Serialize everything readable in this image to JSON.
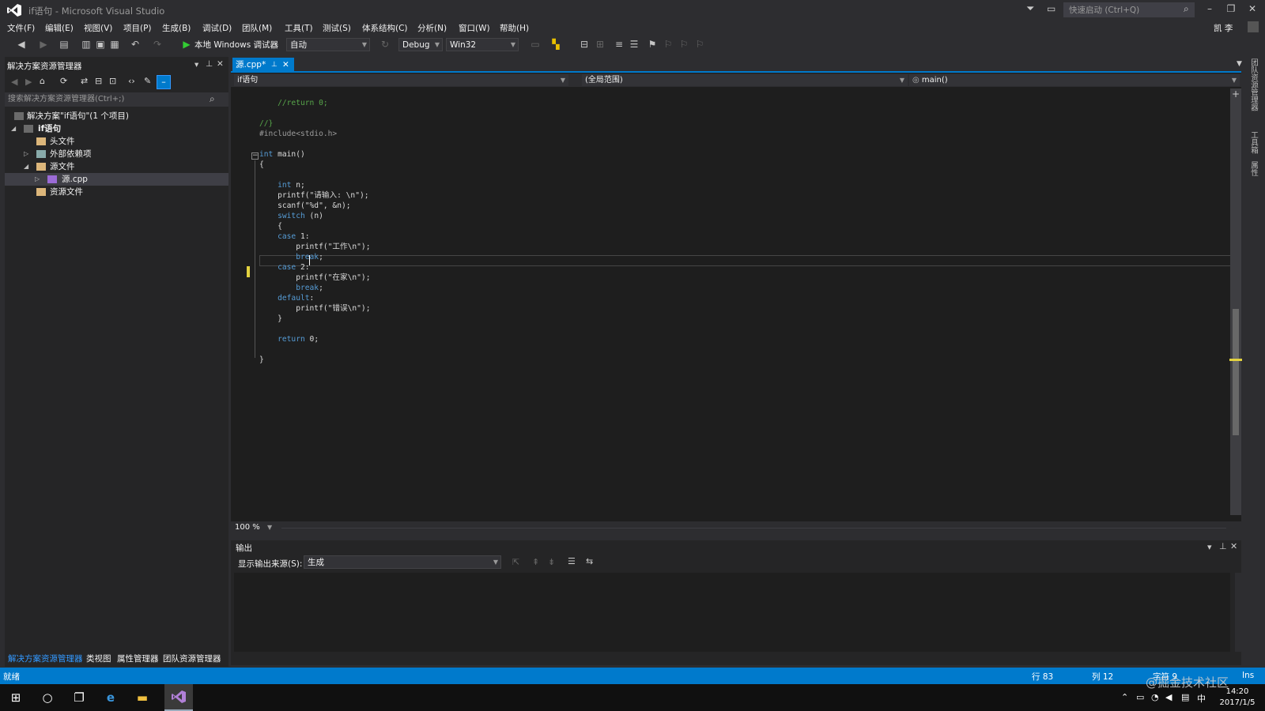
{
  "window": {
    "title": "if语句 - Microsoft Visual Studio",
    "quick_launch": "快速启动 (Ctrl+Q)",
    "user": "凯 李"
  },
  "menu": [
    "文件(F)",
    "编辑(E)",
    "视图(V)",
    "项目(P)",
    "生成(B)",
    "调试(D)",
    "团队(M)",
    "工具(T)",
    "测试(S)",
    "体系结构(C)",
    "分析(N)",
    "窗口(W)",
    "帮助(H)"
  ],
  "toolbar": {
    "run_label": "本地 Windows 调试器",
    "auto": "自动",
    "config": "Debug",
    "platform": "Win32"
  },
  "solution_explorer": {
    "title": "解决方案资源管理器",
    "search_placeholder": "搜索解决方案资源管理器(Ctrl+;)",
    "items": [
      {
        "label": "解决方案\"if语句\"(1 个项目)"
      },
      {
        "label": "if语句"
      },
      {
        "label": "头文件"
      },
      {
        "label": "外部依赖项"
      },
      {
        "label": "源文件"
      },
      {
        "label": "源.cpp"
      },
      {
        "label": "资源文件"
      }
    ],
    "tabs": [
      "解决方案资源管理器",
      "类视图",
      "属性管理器",
      "团队资源管理器"
    ]
  },
  "editor": {
    "tab_label": "源.cpp*",
    "nav_project": "if语句",
    "nav_scope": "(全局范围)",
    "nav_member": "main()",
    "zoom": "100 %",
    "lines": [
      {
        "cls": "cm",
        "text": "    //return 0;"
      },
      {
        "cls": "tx",
        "text": ""
      },
      {
        "cls": "cm",
        "text": "//}"
      },
      {
        "cls": "pp",
        "text": "#include<stdio.h>"
      },
      {
        "cls": "tx",
        "text": ""
      },
      {
        "cls": "kw",
        "text": "int",
        "rest": " main()"
      },
      {
        "cls": "tx",
        "text": "{"
      },
      {
        "cls": "tx",
        "text": ""
      },
      {
        "cls": "kw",
        "text": "    int",
        "rest": " n;"
      },
      {
        "cls": "tx",
        "text": "    printf(\"请输入: \\n\");"
      },
      {
        "cls": "tx",
        "text": "    scanf(\"%d\", &n);"
      },
      {
        "cls": "kw",
        "text": "    switch",
        "rest": " (n)"
      },
      {
        "cls": "tx",
        "text": "    {"
      },
      {
        "cls": "kw",
        "text": "    case",
        "rest": " 1:"
      },
      {
        "cls": "tx",
        "text": "        printf(\"工作\\n\");"
      },
      {
        "cls": "kw",
        "text": "        break",
        "rest": ";"
      },
      {
        "cls": "kw",
        "text": "    case",
        "rest": " 2:"
      },
      {
        "cls": "tx",
        "text": "        printf(\"在家\\n\");"
      },
      {
        "cls": "kw",
        "text": "        break",
        "rest": ";"
      },
      {
        "cls": "kw",
        "text": "    default",
        "rest": ":"
      },
      {
        "cls": "tx",
        "text": "        printf(\"错误\\n\");"
      },
      {
        "cls": "tx",
        "text": "    }"
      },
      {
        "cls": "tx",
        "text": ""
      },
      {
        "cls": "kw",
        "text": "    return",
        "rest": " 0;"
      },
      {
        "cls": "tx",
        "text": ""
      },
      {
        "cls": "tx",
        "text": "}"
      }
    ]
  },
  "output": {
    "title": "输出",
    "source_label": "显示输出来源(S):",
    "source_value": "生成"
  },
  "status": {
    "ready": "就绪",
    "line": "行 83",
    "col": "列 12",
    "char": "字符 9",
    "mode": "Ins"
  },
  "taskbar": {
    "time": "14:20",
    "date": "2017/1/5",
    "ime": "中"
  },
  "watermark": "@掘金技术社区",
  "right_rail": [
    "团队资源管理器",
    "工具箱",
    "属性"
  ],
  "colors": {
    "accent": "#007acc",
    "keyword": "#569cd6",
    "comment": "#57a64a",
    "background": "#1e1e1e"
  }
}
